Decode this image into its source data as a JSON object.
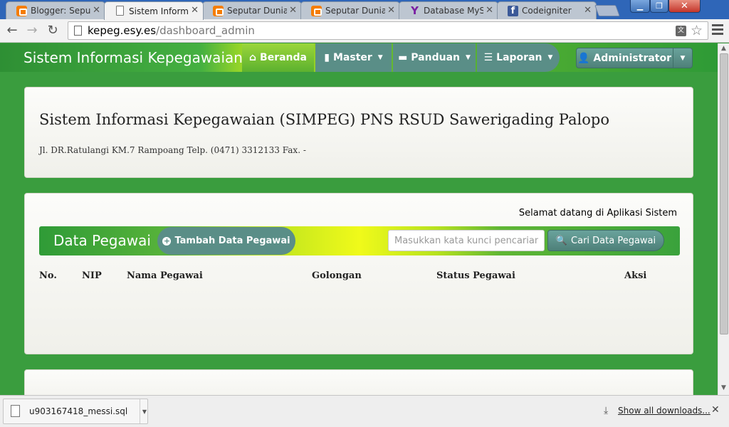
{
  "browser": {
    "tabs": [
      {
        "label": "Blogger: Seputa",
        "icon": "blogger-icon"
      },
      {
        "label": "Sistem Informas",
        "icon": "page-icon"
      },
      {
        "label": "Seputar Dunia I",
        "icon": "blogger-icon"
      },
      {
        "label": "Seputar Dunia I",
        "icon": "blogger-icon"
      },
      {
        "label": "Database MySQ",
        "icon": "yahoo-icon"
      },
      {
        "label": "Codeigniter",
        "icon": "facebook-icon"
      }
    ],
    "active_tab": 1,
    "url_host": "kepeg.esy.es",
    "url_path": "/dashboard_admin"
  },
  "navbar": {
    "brand": "Sistem Informasi Kepegawaian",
    "items": [
      {
        "label": "Beranda",
        "icon": "home-icon",
        "active": true
      },
      {
        "label": "Master",
        "icon": "book-icon",
        "dropdown": true
      },
      {
        "label": "Panduan",
        "icon": "comment-icon",
        "dropdown": true
      },
      {
        "label": "Laporan",
        "icon": "list-icon",
        "dropdown": true
      }
    ],
    "user": {
      "label": "Administrator",
      "icon": "user-icon"
    }
  },
  "header": {
    "title": "Sistem Informasi Kepegawaian (SIMPEG) PNS RSUD Sawerigading Palopo",
    "address": "Jl. DR.Ratulangi KM.7 Rampoang Telp. (0471) 3312133 Fax. -"
  },
  "data_panel": {
    "welcome": "Selamat datang di Aplikasi Sistem",
    "title": "Data Pegawai",
    "add_button": "Tambah Data Pegawai",
    "search_placeholder": "Masukkan kata kunci pencarian",
    "search_button": "Cari Data Pegawai",
    "columns": [
      "No.",
      "NIP",
      "Nama Pegawai",
      "Golongan",
      "Status Pegawai",
      "Aksi"
    ]
  },
  "downloads": {
    "file_name": "u903167418_messi.sql",
    "show_all": "Show all downloads..."
  },
  "colors": {
    "page_bg": "#3a9d3e",
    "nav_teal": "#5a8e87",
    "accent_yellow": "#f0fa1a"
  }
}
